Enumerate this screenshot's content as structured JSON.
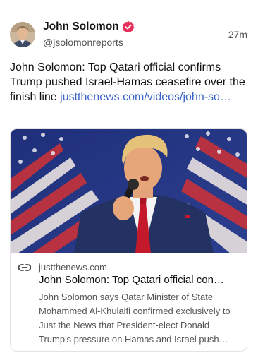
{
  "post": {
    "author_name": "John Solomon",
    "author_handle": "@jsolomonreports",
    "timestamp": "27m",
    "avatar_icon": "avatar-photo",
    "verified_icon": "verified-badge-icon",
    "verified_color": "#e5305c",
    "text": "John Solomon: Top Qatari official confirms Trump pushed Israel-Hamas ceasefire over the finish line ",
    "link_text": "justthenews.com/videos/john-so…",
    "link_color": "#3a64c8"
  },
  "card": {
    "image_icon": "speaker-at-microphone-photo",
    "link_icon": "link-icon",
    "domain": "justthenews.com",
    "title": "John Solomon: Top Qatari official con…",
    "description": "John Solomon says Qatar Minister of State Mohammed Al-Khulaifi confirmed exclusively to Just the News that President-elect Donald Trump's pressure on Hamas and Israel push…"
  }
}
